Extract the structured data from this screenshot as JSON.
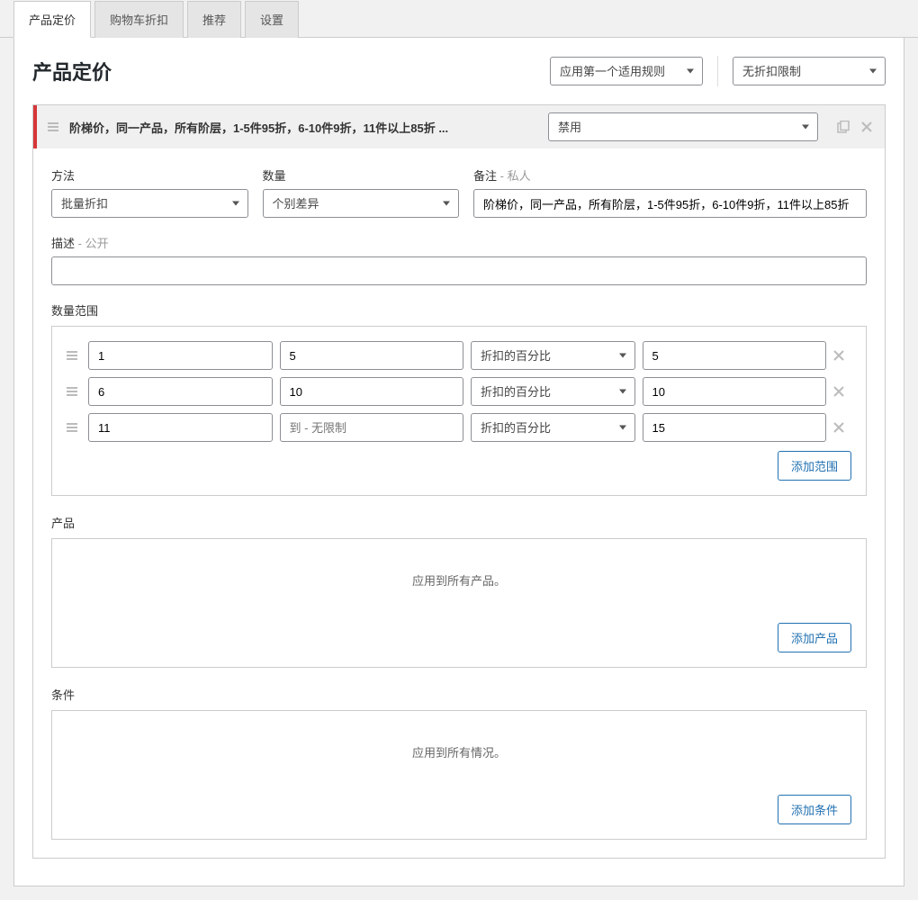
{
  "tabs": [
    {
      "label": "产品定价",
      "active": true
    },
    {
      "label": "购物车折扣",
      "active": false
    },
    {
      "label": "推荐",
      "active": false
    },
    {
      "label": "设置",
      "active": false
    }
  ],
  "header": {
    "title": "产品定价",
    "rule_mode": "应用第一个适用规则",
    "discount_limit": "无折扣限制"
  },
  "rule": {
    "title": "阶梯价，同一产品，所有阶层，1-5件95折，6-10件9折，11件以上85折 ...",
    "status": "禁用",
    "fields": {
      "method_label": "方法",
      "method_value": "批量折扣",
      "quantity_label": "数量",
      "quantity_value": "个别差异",
      "note_label": "备注",
      "note_hint": " - 私人",
      "note_value": "阶梯价，同一产品，所有阶层，1-5件95折，6-10件9折，11件以上85折",
      "desc_label": "描述",
      "desc_hint": " - 公开",
      "desc_value": ""
    },
    "ranges": {
      "label": "数量范围",
      "type_option": "折扣的百分比",
      "unlimited_placeholder": "到 - 无限制",
      "rows": [
        {
          "from": "1",
          "to": "5",
          "value": "5"
        },
        {
          "from": "6",
          "to": "10",
          "value": "10"
        },
        {
          "from": "11",
          "to": "",
          "value": "15"
        }
      ],
      "add_button": "添加范围"
    },
    "products": {
      "label": "产品",
      "empty": "应用到所有产品。",
      "add_button": "添加产品"
    },
    "conditions": {
      "label": "条件",
      "empty": "应用到所有情况。",
      "add_button": "添加条件"
    }
  }
}
